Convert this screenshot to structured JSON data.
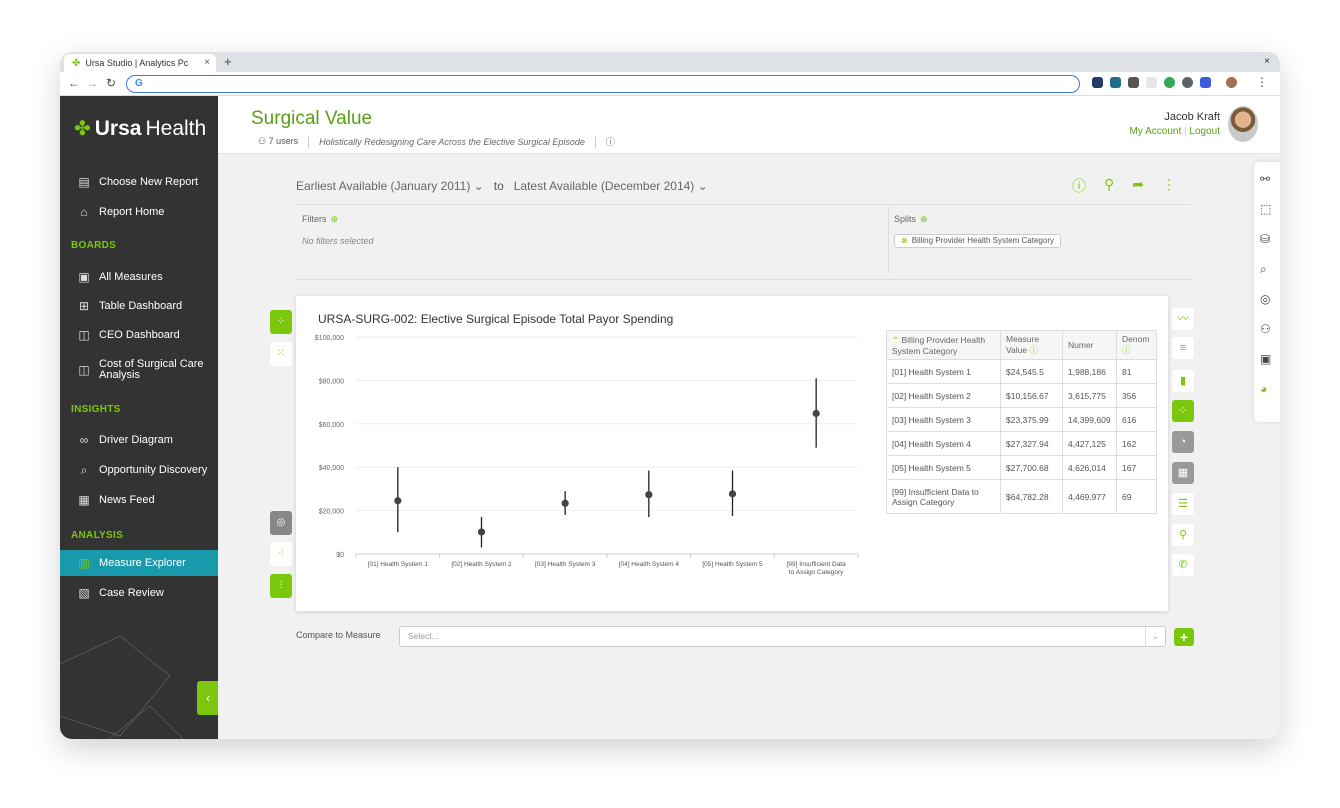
{
  "browser": {
    "tab_title": "Ursa Studio | Analytics Pc",
    "address": "G"
  },
  "app": {
    "logo_bold": "Ursa",
    "logo_light": "Health"
  },
  "sidebar": {
    "top_items": [
      {
        "label": "Choose New Report",
        "icon": "document-icon"
      },
      {
        "label": "Report Home",
        "icon": "home-icon"
      }
    ],
    "boards_heading": "BOARDS",
    "boards": [
      {
        "label": "All Measures",
        "icon": "measures-icon"
      },
      {
        "label": "Table Dashboard",
        "icon": "table-icon"
      },
      {
        "label": "CEO Dashboard",
        "icon": "dashboard-icon"
      },
      {
        "label": "Cost of Surgical Care Analysis",
        "icon": "dashboard-icon"
      }
    ],
    "insights_heading": "INSIGHTS",
    "insights": [
      {
        "label": "Driver Diagram",
        "icon": "diagram-icon"
      },
      {
        "label": "Opportunity Discovery",
        "icon": "search-icon"
      },
      {
        "label": "News Feed",
        "icon": "news-icon"
      }
    ],
    "analysis_heading": "ANALYSIS",
    "analysis": [
      {
        "label": "Measure Explorer",
        "icon": "chart-icon",
        "active": true
      },
      {
        "label": "Case Review",
        "icon": "case-icon"
      }
    ]
  },
  "header": {
    "title": "Surgical Value",
    "users": "7 users",
    "description": "Holistically Redesigning Care Across the Elective Surgical Episode",
    "user_name": "Jacob Kraft",
    "my_account": "My Account",
    "logout": "Logout"
  },
  "daterange": {
    "start": "Earliest Available (January 2011)",
    "to": "to",
    "end": "Latest Available (December 2014)"
  },
  "filters": {
    "label": "Filters",
    "empty": "No filters selected"
  },
  "splits": {
    "label": "Splits",
    "chip": "Billing Provider Health System Category"
  },
  "compare": {
    "label": "Compare to Measure",
    "placeholder": "Select..."
  },
  "colors": {
    "accent": "#7ac70c",
    "active_nav": "#199aac",
    "sidebar": "#333333",
    "title": "#5a9e16"
  },
  "table": {
    "headers": [
      "Billing Provider Health System Category",
      "Measure Value",
      "Numer",
      "Denom"
    ],
    "rows": [
      [
        "[01] Health System 1",
        "$24,545.5",
        "1,988,186",
        "81"
      ],
      [
        "[02] Health System 2",
        "$10,156.67",
        "3,615,775",
        "356"
      ],
      [
        "[03] Health System 3",
        "$23,375.99",
        "14,399,609",
        "616"
      ],
      [
        "[04] Health System 4",
        "$27,327.94",
        "4,427,125",
        "162"
      ],
      [
        "[05] Health System 5",
        "$27,700.68",
        "4,626,014",
        "167"
      ],
      [
        "[99] Insufficient Data to Assign Category",
        "$64,782.28",
        "4,469,977",
        "69"
      ]
    ]
  },
  "chart_data": {
    "type": "scatter",
    "title": "URSA-SURG-002: Elective Surgical Episode Total Payor Spending",
    "categories": [
      "[01] Health System 1",
      "[02] Health System 2",
      "[03] Health System 3",
      "[04] Health System 4",
      "[05] Health System 5",
      "[99] Insufficient Data to Assign Category"
    ],
    "values": [
      24545.5,
      10156.67,
      23375.99,
      27327.94,
      27700.68,
      64782.28
    ],
    "error_low": [
      10000,
      3000,
      18000,
      17000,
      17500,
      49000
    ],
    "error_high": [
      40000,
      17000,
      29000,
      38500,
      38500,
      81000
    ],
    "yticks": [
      "$0",
      "$20,000",
      "$40,000",
      "$60,000",
      "$80,000",
      "$100,000"
    ],
    "ylim": [
      0,
      100000
    ],
    "grid": true
  }
}
